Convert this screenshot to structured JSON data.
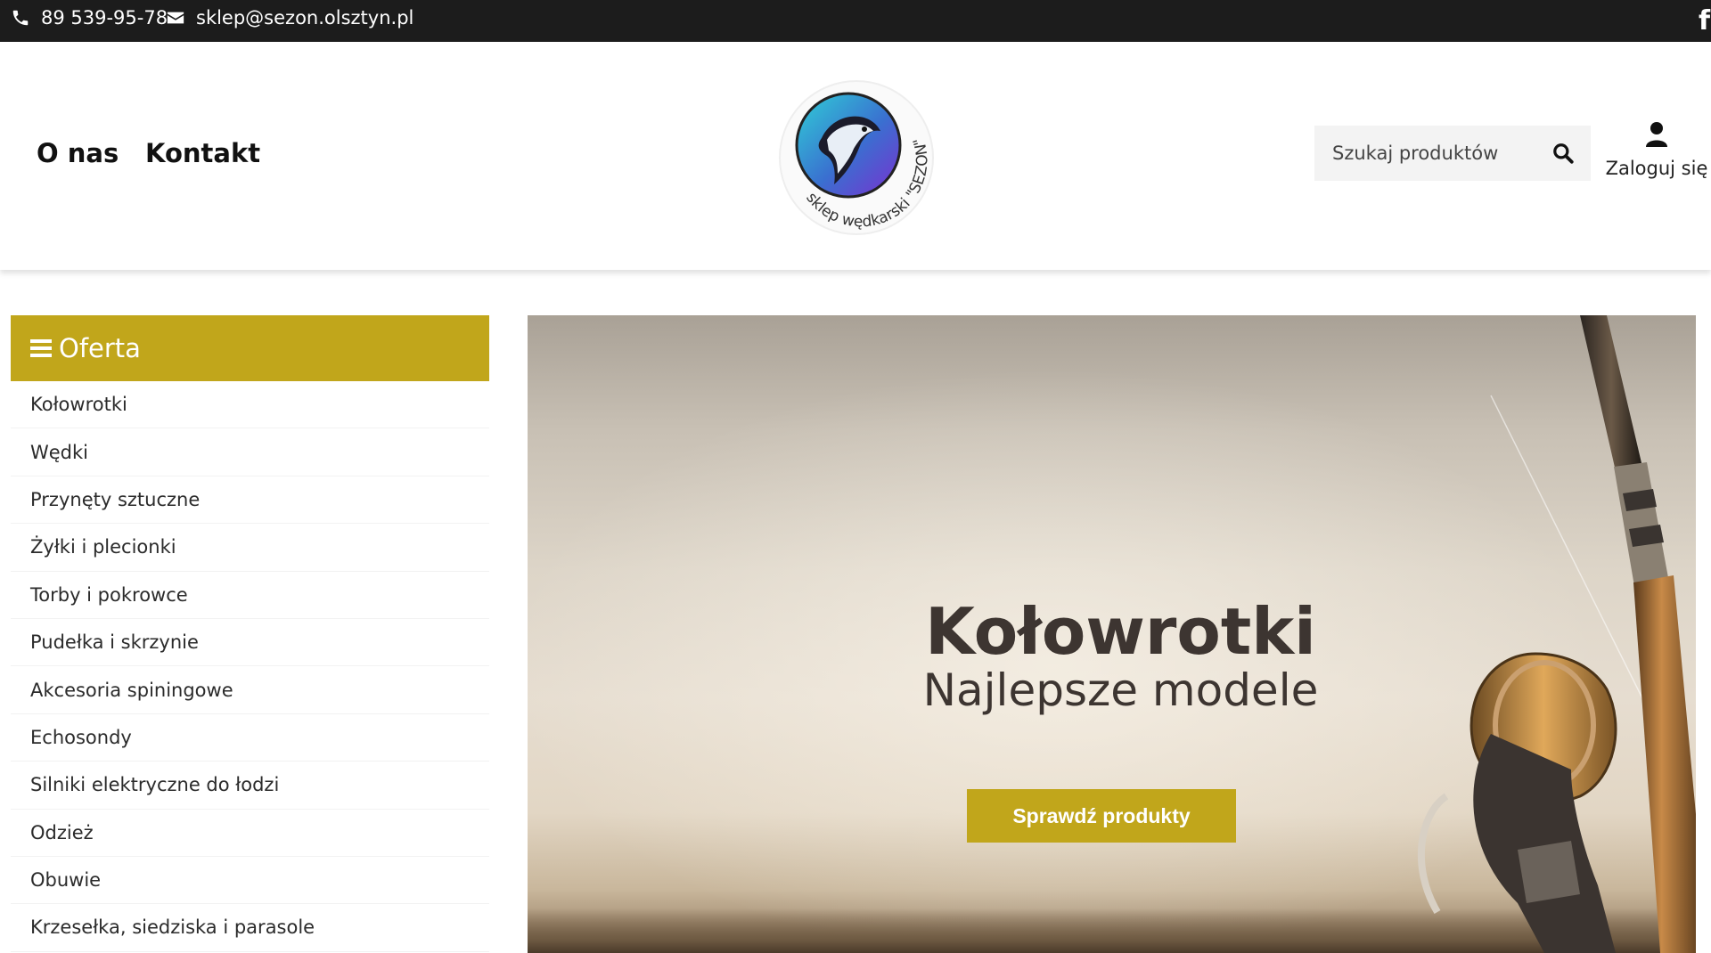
{
  "topbar": {
    "phone": "89 539-95-78",
    "email": "sklep@sezon.olsztyn.pl",
    "phone_icon": "phone-icon",
    "email_icon": "envelope-icon",
    "social_icon": "facebook-icon"
  },
  "header": {
    "nav": [
      {
        "label": "O nas"
      },
      {
        "label": "Kontakt"
      }
    ],
    "logo_text": "sklep wędkarski \"SEZON\"",
    "search": {
      "placeholder": "Szukaj produktów",
      "icon": "search-icon"
    },
    "login": {
      "label": "Zaloguj się",
      "icon": "user-icon"
    }
  },
  "sidebar": {
    "title": "Oferta",
    "items": [
      {
        "label": "Kołowrotki"
      },
      {
        "label": "Wędki"
      },
      {
        "label": "Przynęty sztuczne"
      },
      {
        "label": "Żyłki i plecionki"
      },
      {
        "label": "Torby i pokrowce"
      },
      {
        "label": "Pudełka i skrzynie"
      },
      {
        "label": "Akcesoria spiningowe"
      },
      {
        "label": "Echosondy"
      },
      {
        "label": "Silniki elektryczne do łodzi"
      },
      {
        "label": "Odzież"
      },
      {
        "label": "Obuwie"
      },
      {
        "label": "Krzesełka, siedziska i parasole"
      }
    ]
  },
  "hero": {
    "title": "Kołowrotki",
    "subtitle": "Najlepsze modele",
    "button": "Sprawdź produkty"
  },
  "colors": {
    "accent": "#c1a61b",
    "topbar_bg": "#1c1c1c",
    "hero_text": "#3d3531"
  }
}
